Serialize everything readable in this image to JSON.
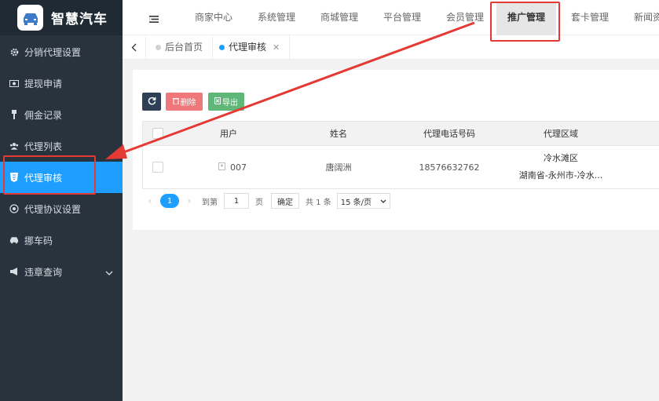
{
  "app": {
    "title": "智慧汽车"
  },
  "sidebar": {
    "items": [
      {
        "label": "分销代理设置",
        "icon": "gear-icon"
      },
      {
        "label": "提现申请",
        "icon": "money-icon"
      },
      {
        "label": "佣金记录",
        "icon": "pin-icon"
      },
      {
        "label": "代理列表",
        "icon": "users-icon"
      },
      {
        "label": "代理审核",
        "icon": "html5-icon",
        "active": true
      },
      {
        "label": "代理协议设置",
        "icon": "settings-circle-icon"
      },
      {
        "label": "挪车码",
        "icon": "car-icon"
      },
      {
        "label": "违章查询",
        "icon": "bullhorn-icon",
        "has_children": true
      }
    ]
  },
  "topnav": {
    "items": [
      "商家中心",
      "系统管理",
      "商城管理",
      "平台管理",
      "会员管理",
      "推广管理",
      "套卡管理",
      "新闻资"
    ],
    "active": "推广管理"
  },
  "tabs": [
    {
      "label": "后台首页",
      "active": false,
      "closable": false
    },
    {
      "label": "代理审核",
      "active": true,
      "closable": true
    }
  ],
  "toolbar": {
    "refresh_icon": "refresh-icon",
    "delete_label": "删除",
    "export_label": "导出"
  },
  "table": {
    "columns": [
      "用户",
      "姓名",
      "代理电话号码",
      "代理区域"
    ],
    "rows": [
      {
        "user": "007",
        "name": "唐阔洲",
        "phone": "18576632762",
        "area_line1": "冷水滩区",
        "area_line2": "湖南省-永州市-冷水..."
      }
    ]
  },
  "pager": {
    "current_page": "1",
    "goto_label": "到第",
    "goto_value": "1",
    "page_suffix": "页",
    "confirm_label": "确定",
    "total_label": "共 1 条",
    "page_size": "15 条/页"
  },
  "colors": {
    "sidebar_bg": "#28333e",
    "active_blue": "#1e9fff",
    "annotation_red": "#e53935"
  }
}
